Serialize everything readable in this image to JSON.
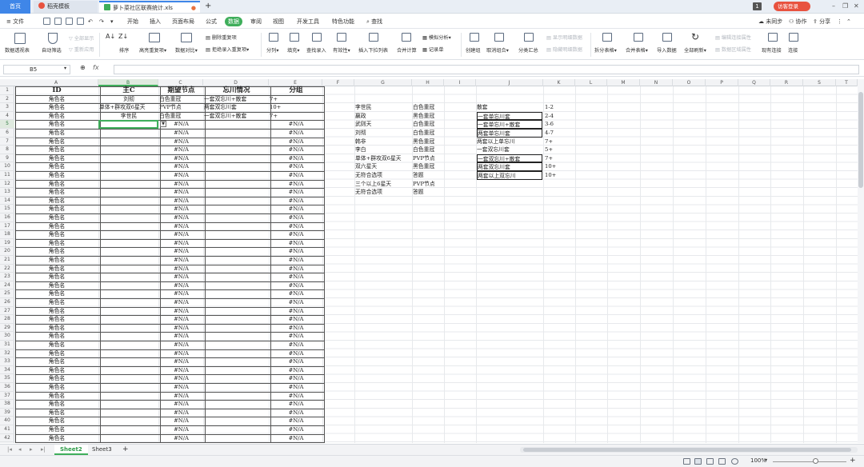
{
  "title_tabs": {
    "home": "首页",
    "template": "稻壳模板",
    "file": "萝卜菜社区联赛统计.xls"
  },
  "title_right": {
    "badge": "1",
    "login": "访客登录"
  },
  "menu": {
    "file": "文件",
    "items": [
      "开始",
      "插入",
      "页面布局",
      "公式",
      "数据",
      "审阅",
      "视图",
      "开发工具",
      "特色功能"
    ],
    "active": "数据",
    "search": "查找",
    "right": [
      "未同步",
      "协作",
      "分享"
    ]
  },
  "ribbon": [
    "数据透视表",
    "自动筛选",
    "全部显示",
    "重新应用",
    "排序",
    "高亮重复项",
    "数据对比",
    "删除重复项",
    "拒绝录入重复项",
    "分列",
    "填充",
    "查找录入",
    "有效性",
    "插入下拉列表",
    "合并计算",
    "模拟分析",
    "记录单",
    "创建组",
    "取消组合",
    "分类汇总",
    "显示明细数据",
    "隐藏明细数据",
    "拆分表格",
    "合并表格",
    "导入数据",
    "全部刷新",
    "编辑连接属性",
    "数据区域属性",
    "现有连接",
    "连接"
  ],
  "formula_bar": {
    "name_box": "B5",
    "fx": "fx",
    "content": ""
  },
  "columns": [
    "A",
    "B",
    "C",
    "D",
    "E",
    "F",
    "G",
    "H",
    "I",
    "J",
    "K",
    "L",
    "M",
    "N",
    "O",
    "P",
    "Q",
    "R",
    "S",
    "T"
  ],
  "selected_column": "B",
  "rows": [
    "1",
    "2",
    "3",
    "4",
    "5",
    "6",
    "7",
    "8",
    "9",
    "10",
    "11",
    "12",
    "13",
    "14",
    "15",
    "16",
    "17",
    "18",
    "19",
    "20",
    "21",
    "22",
    "23",
    "24",
    "25",
    "26",
    "27",
    "28",
    "29",
    "30",
    "31",
    "32",
    "33",
    "34",
    "35",
    "36",
    "37",
    "38",
    "39",
    "40",
    "41",
    "42"
  ],
  "selected_row": "5",
  "table": {
    "headers": [
      "ID",
      "主C",
      "期望节点",
      "忘川情况",
      "分组"
    ],
    "id_value": "角色名",
    "na_value": "#N/A",
    "data_rows": [
      {
        "b": "刘彻",
        "c": "白色重冠",
        "d": "一套双忘川+散套",
        "e": "7+"
      },
      {
        "b": "单体+群攻双6星天",
        "c": "PVP节点",
        "d": "两套双忘川套",
        "e": "10+"
      },
      {
        "b": "李世民",
        "c": "白色重冠",
        "d": "一套双忘川+散套",
        "e": "7+"
      }
    ]
  },
  "lookup_gh": [
    [
      "李世民",
      "白色重冠"
    ],
    [
      "嬴政",
      "黑色重冠"
    ],
    [
      "武则天",
      "白色重冠"
    ],
    [
      "刘彻",
      "白色重冠"
    ],
    [
      "韩非",
      "黑色重冠"
    ],
    [
      "李白",
      "白色重冠"
    ],
    [
      "单体+群攻双6星天",
      "PVP节点"
    ],
    [
      "双六星天",
      "黑色重冠"
    ],
    [
      "无符合选项",
      "答题"
    ],
    [
      "三个以上6星天",
      "PVP节点"
    ],
    [
      "无符合选项",
      "答题"
    ]
  ],
  "lookup_jk": [
    [
      "散套",
      "1-2"
    ],
    [
      "一套单忘川套",
      "2-4"
    ],
    [
      "一套单忘川+散套",
      "3-6"
    ],
    [
      "两套单忘川套",
      "4-7"
    ],
    [
      "两套以上单忘川",
      "7+"
    ],
    [
      "一套双忘川套",
      "5+"
    ],
    [
      "一套双忘川+散套",
      "7+"
    ],
    [
      "两套双忘川套",
      "10+"
    ],
    [
      "两套以上双忘川",
      "10+"
    ]
  ],
  "sheets": [
    "Sheet2",
    "Sheet3"
  ],
  "active_sheet": "Sheet2",
  "zoom": "100%"
}
